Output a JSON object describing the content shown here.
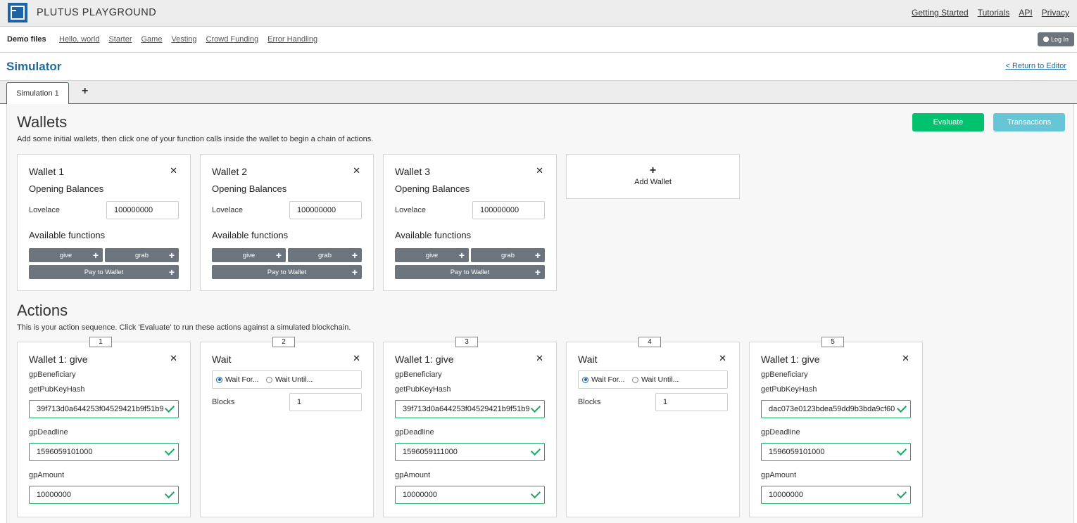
{
  "header": {
    "title": "PLUTUS PLAYGROUND",
    "links": [
      "Getting Started",
      "Tutorials",
      "API",
      "Privacy"
    ]
  },
  "demo": {
    "label": "Demo files",
    "files": [
      "Hello, world",
      "Starter",
      "Game",
      "Vesting",
      "Crowd Funding",
      "Error Handling"
    ],
    "login": "Log In"
  },
  "simulator": {
    "title": "Simulator",
    "return_link": "< Return to Editor",
    "tabs": [
      "Simulation 1"
    ],
    "add_tab": "+"
  },
  "wallets": {
    "heading": "Wallets",
    "description": "Add some initial wallets, then click one of your function calls inside the wallet to begin a chain of actions.",
    "evaluate": "Evaluate",
    "transactions": "Transactions",
    "opening_balances": "Opening Balances",
    "available_functions": "Available functions",
    "currency_label": "Lovelace",
    "functions": [
      "give",
      "grab",
      "Pay to Wallet"
    ],
    "items": [
      {
        "title": "Wallet 1",
        "lovelace": "100000000"
      },
      {
        "title": "Wallet 2",
        "lovelace": "100000000"
      },
      {
        "title": "Wallet 3",
        "lovelace": "100000000"
      }
    ],
    "add_wallet": "Add Wallet"
  },
  "actions": {
    "heading": "Actions",
    "description": "This is your action sequence. Click 'Evaluate' to run these actions against a simulated blockchain.",
    "field_labels": {
      "beneficiary": "gpBeneficiary",
      "pubkey": "getPubKeyHash",
      "deadline": "gpDeadline",
      "amount": "gpAmount",
      "blocks": "Blocks",
      "wait_for": "Wait For...",
      "wait_until": "Wait Until..."
    },
    "items": [
      {
        "seq": "1",
        "title": "Wallet 1: give",
        "pubkey": "39f713d0a644253f04529421b9f51b9",
        "deadline": "1596059101000",
        "amount": "10000000"
      },
      {
        "seq": "2",
        "title": "Wait",
        "blocks": "1"
      },
      {
        "seq": "3",
        "title": "Wallet 1: give",
        "pubkey": "39f713d0a644253f04529421b9f51b9",
        "deadline": "1596059111000",
        "amount": "10000000"
      },
      {
        "seq": "4",
        "title": "Wait",
        "blocks": "1"
      },
      {
        "seq": "5",
        "title": "Wallet 1: give",
        "pubkey": "dac073e0123bdea59dd9b3bda9cf60",
        "deadline": "1596059101000",
        "amount": "10000000"
      }
    ]
  }
}
